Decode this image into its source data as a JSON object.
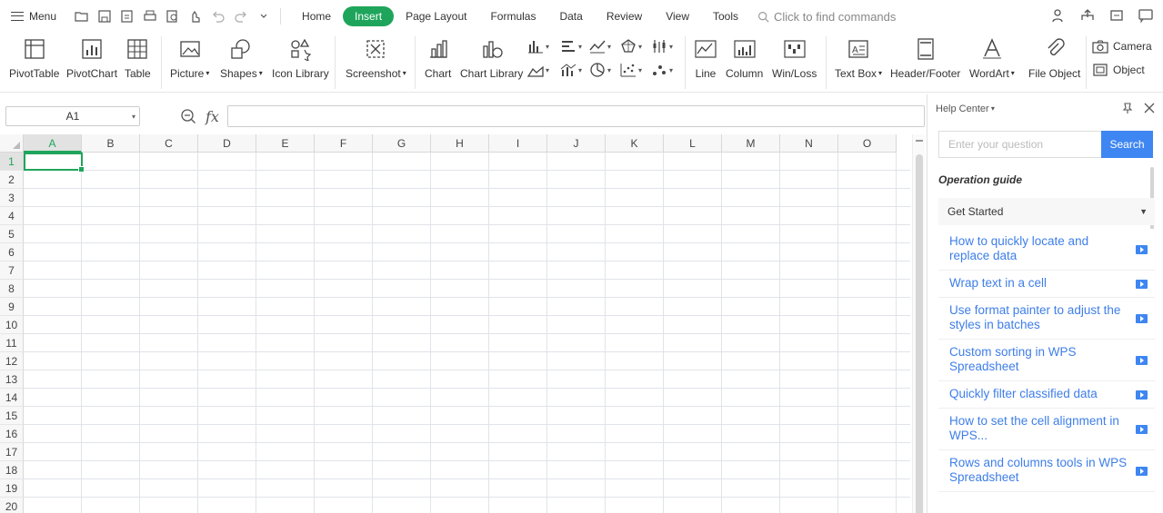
{
  "topbar": {
    "menu_label": "Menu",
    "tabs": [
      {
        "label": "Home",
        "active": false
      },
      {
        "label": "Insert",
        "active": true
      },
      {
        "label": "Page Layout",
        "active": false
      },
      {
        "label": "Formulas",
        "active": false
      },
      {
        "label": "Data",
        "active": false
      },
      {
        "label": "Review",
        "active": false
      },
      {
        "label": "View",
        "active": false
      },
      {
        "label": "Tools",
        "active": false
      }
    ],
    "find_placeholder": "Click to find commands",
    "accent_color": "#1fa55b"
  },
  "ribbon": {
    "pivot_table": "PivotTable",
    "pivot_chart": "PivotChart",
    "table": "Table",
    "picture": "Picture",
    "shapes": "Shapes",
    "icon_library": "Icon Library",
    "screenshot": "Screenshot",
    "chart": "Chart",
    "chart_library": "Chart Library",
    "line": "Line",
    "column": "Column",
    "win_loss": "Win/Loss",
    "text_box": "Text Box",
    "header_footer": "Header/Footer",
    "wordart": "WordArt",
    "file_object": "File Object",
    "camera": "Camera",
    "object": "Object"
  },
  "formula_bar": {
    "name_box": "A1",
    "fx_label": "fx",
    "formula_value": ""
  },
  "sheet": {
    "columns": [
      "A",
      "B",
      "C",
      "D",
      "E",
      "F",
      "G",
      "H",
      "I",
      "J",
      "K",
      "L",
      "M",
      "N",
      "O"
    ],
    "rows": [
      "1",
      "2",
      "3",
      "4",
      "5",
      "6",
      "7",
      "8",
      "9",
      "10",
      "11",
      "12",
      "13",
      "14",
      "15",
      "16",
      "17",
      "18",
      "19",
      "20"
    ],
    "selected_cell": "A1"
  },
  "help_panel": {
    "title": "Help Center",
    "search_placeholder": "Enter your question",
    "search_button": "Search",
    "section_title": "Operation guide",
    "group_title": "Get Started",
    "items": [
      "How to quickly locate and replace data",
      "Wrap text in a cell",
      "Use format painter to adjust the styles in batches",
      "Custom sorting in WPS Spreadsheet",
      "Quickly filter classified data",
      "How to set the cell alignment in WPS...",
      "Rows and columns tools in WPS Spreadsheet"
    ],
    "link_color": "#3e7ee8"
  }
}
